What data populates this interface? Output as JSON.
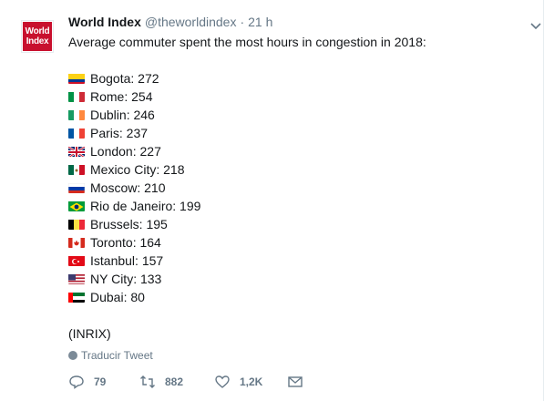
{
  "author": {
    "name": "World Index",
    "handle": "@theworldindex",
    "separator": "·",
    "time": "21 h",
    "avatar_text_1": "World",
    "avatar_text_2": "Index"
  },
  "tweet": {
    "intro": "Average commuter spent the most hours in congestion in 2018:",
    "items": [
      {
        "label": "Bogota: 272",
        "flag": "colombia"
      },
      {
        "label": "Rome: 254",
        "flag": "italy"
      },
      {
        "label": "Dublin: 246",
        "flag": "ireland"
      },
      {
        "label": "Paris: 237",
        "flag": "france"
      },
      {
        "label": "London: 227",
        "flag": "uk"
      },
      {
        "label": "Mexico City: 218",
        "flag": "mexico"
      },
      {
        "label": "Moscow: 210",
        "flag": "russia"
      },
      {
        "label": "Rio de Janeiro: 199",
        "flag": "brazil"
      },
      {
        "label": "Brussels: 195",
        "flag": "belgium"
      },
      {
        "label": "Toronto: 164",
        "flag": "canada"
      },
      {
        "label": "Istanbul: 157",
        "flag": "turkey"
      },
      {
        "label": "NY City: 133",
        "flag": "usa"
      },
      {
        "label": "Dubai: 80",
        "flag": "uae"
      }
    ],
    "source": "(INRIX)",
    "translate_label": "Traducir Tweet"
  },
  "actions": {
    "replies": "79",
    "retweets": "882",
    "likes": "1,2K"
  },
  "colors": {
    "text": "#14171a",
    "secondary": "#657786",
    "logo_red": "#c8102e"
  }
}
